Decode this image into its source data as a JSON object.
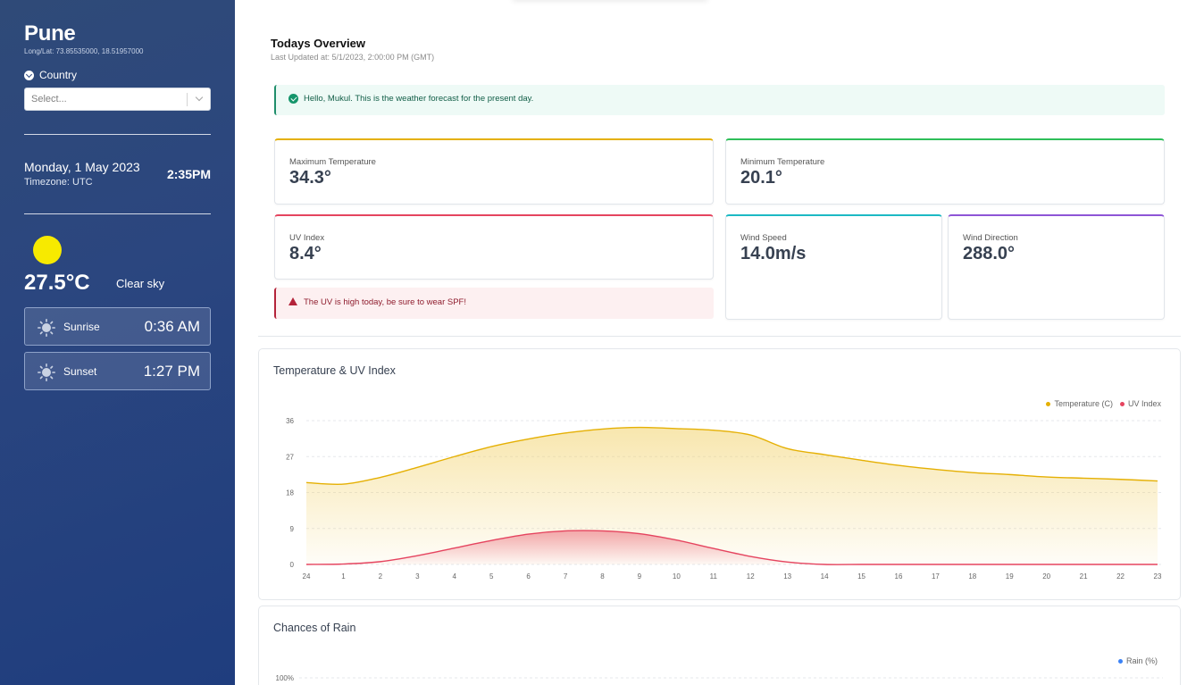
{
  "sidebar": {
    "city": "Pune",
    "coords": "Long/Lat: 73.85535000, 18.51957000",
    "country_label": "Country",
    "select_placeholder": "Select...",
    "date": "Monday, 1 May 2023",
    "timezone": "Timezone: UTC",
    "time": "2:35PM",
    "temperature": "27.5°C",
    "condition": "Clear sky",
    "sunrise_label": "Sunrise",
    "sunrise_time": "0:36 AM",
    "sunset_label": "Sunset",
    "sunset_time": "1:27 PM"
  },
  "overview": {
    "title": "Todays Overview",
    "updated": "Last Updated at: 5/1/2023, 2:00:00 PM (GMT)",
    "greeting": "Hello, Mukul. This is the weather forecast for the present day.",
    "uv_warning": "The UV is high today, be sure to wear SPF!"
  },
  "cards": {
    "max_temp_label": "Maximum Temperature",
    "max_temp_value": "34.3°",
    "min_temp_label": "Minimum Temperature",
    "min_temp_value": "20.1°",
    "uv_label": "UV Index",
    "uv_value": "8.4°",
    "wind_speed_label": "Wind Speed",
    "wind_speed_value": "14.0m/s",
    "wind_dir_label": "Wind Direction",
    "wind_dir_value": "288.0°"
  },
  "colors": {
    "max_temp": "#e5b004",
    "min_temp": "#2fbf5a",
    "uv": "#e5445f",
    "wind_speed": "#1cb9c4",
    "wind_dir": "#8e55d6",
    "rain": "#3b82f6"
  },
  "chart_temp_title": "Temperature & UV Index",
  "chart_rain_title": "Chances of Rain",
  "chart_data": [
    {
      "type": "area",
      "title": "Temperature & UV Index",
      "x": [
        "24",
        "1",
        "2",
        "3",
        "4",
        "5",
        "6",
        "7",
        "8",
        "9",
        "10",
        "11",
        "12",
        "13",
        "14",
        "15",
        "16",
        "17",
        "18",
        "19",
        "20",
        "21",
        "22",
        "23"
      ],
      "yticks": [
        "0",
        "9",
        "18",
        "27",
        "36"
      ],
      "ylim": [
        0,
        36
      ],
      "legend_position": "top-right",
      "grid": true,
      "series": [
        {
          "name": "Temperature (C)",
          "color": "#e5b004",
          "values": [
            20.5,
            20.1,
            21.8,
            24.3,
            27.0,
            29.5,
            31.4,
            32.9,
            33.9,
            34.3,
            34.0,
            33.6,
            32.4,
            29.0,
            27.5,
            26.1,
            24.8,
            23.8,
            23.0,
            22.5,
            21.9,
            21.6,
            21.3,
            20.9
          ]
        },
        {
          "name": "UV Index",
          "color": "#e5445f",
          "values": [
            0,
            0.1,
            0.7,
            2.2,
            4.1,
            6.0,
            7.6,
            8.4,
            8.4,
            7.7,
            6.1,
            4.0,
            2.0,
            0.6,
            0,
            0,
            0,
            0,
            0,
            0,
            0,
            0,
            0,
            0
          ]
        }
      ]
    },
    {
      "type": "line",
      "title": "Chances of Rain",
      "yticks_visible": [
        "100%"
      ],
      "legend_position": "top-right",
      "series": [
        {
          "name": "Rain (%)",
          "color": "#3b82f6"
        }
      ]
    }
  ]
}
